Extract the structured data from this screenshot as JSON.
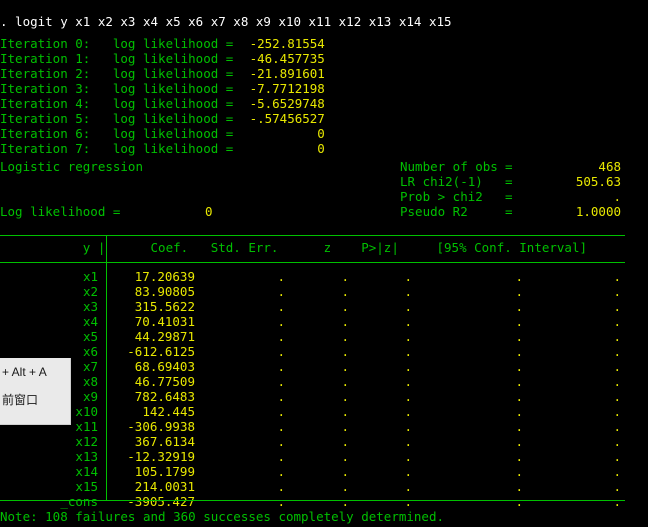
{
  "terminal": {
    "background_color": "#000000",
    "command_color": "#ffffff",
    "label_color": "#00c000",
    "value_color": "#e8e800"
  },
  "command": {
    "prompt": ".",
    "text": ". logit y x1 x2 x3 x4 x5 x6 x7 x8 x9 x10 x11 x12 x13 x14 x15"
  },
  "iterations": [
    {
      "line": "Iteration 0:   log likelihood = ",
      "value": "-252.81554"
    },
    {
      "line": "Iteration 1:   log likelihood = ",
      "value": "-46.457735"
    },
    {
      "line": "Iteration 2:   log likelihood = ",
      "value": "-21.891601"
    },
    {
      "line": "Iteration 3:   log likelihood = ",
      "value": "-7.7712198"
    },
    {
      "line": "Iteration 4:   log likelihood = ",
      "value": "-5.6529748"
    },
    {
      "line": "Iteration 5:   log likelihood = ",
      "value": "-.57456527"
    },
    {
      "line": "Iteration 6:   log likelihood = ",
      "value": "0"
    },
    {
      "line": "Iteration 7:   log likelihood = ",
      "value": "0"
    }
  ],
  "header": {
    "model_title": "Logistic regression",
    "log_likelihood_label": "Log likelihood = ",
    "log_likelihood_value": "0",
    "stats": [
      {
        "label": "Number of obs",
        "eq": "=",
        "value": "468"
      },
      {
        "label": "LR chi2(-1)",
        "eq": "=",
        "value": "505.63"
      },
      {
        "label": "Prob > chi2",
        "eq": "=",
        "value": "."
      },
      {
        "label": "Pseudo R2",
        "eq": "=",
        "value": "1.0000"
      }
    ]
  },
  "table": {
    "dep_var_header": "y",
    "columns": [
      "Coef.",
      "Std. Err.",
      "z",
      "P>|z|",
      "[95% Conf. Interval]"
    ],
    "header_line": "           y |      Coef.   Std. Err.      z    P>|z|     [95% Conf. Interval]",
    "missing_symbol": ".",
    "rows": [
      {
        "name": "x1",
        "coef": "17.20639",
        "stderr": ".",
        "z": ".",
        "p": ".",
        "ci_low": ".",
        "ci_high": "."
      },
      {
        "name": "x2",
        "coef": "83.90805",
        "stderr": ".",
        "z": ".",
        "p": ".",
        "ci_low": ".",
        "ci_high": "."
      },
      {
        "name": "x3",
        "coef": "315.5622",
        "stderr": ".",
        "z": ".",
        "p": ".",
        "ci_low": ".",
        "ci_high": "."
      },
      {
        "name": "x4",
        "coef": "70.41031",
        "stderr": ".",
        "z": ".",
        "p": ".",
        "ci_low": ".",
        "ci_high": "."
      },
      {
        "name": "x5",
        "coef": "44.29871",
        "stderr": ".",
        "z": ".",
        "p": ".",
        "ci_low": ".",
        "ci_high": "."
      },
      {
        "name": "x6",
        "coef": "-612.6125",
        "stderr": ".",
        "z": ".",
        "p": ".",
        "ci_low": ".",
        "ci_high": "."
      },
      {
        "name": "x7",
        "coef": "68.69403",
        "stderr": ".",
        "z": ".",
        "p": ".",
        "ci_low": ".",
        "ci_high": "."
      },
      {
        "name": "x8",
        "coef": "46.77509",
        "stderr": ".",
        "z": ".",
        "p": ".",
        "ci_low": ".",
        "ci_high": "."
      },
      {
        "name": "x9",
        "coef": "782.6483",
        "stderr": ".",
        "z": ".",
        "p": ".",
        "ci_low": ".",
        "ci_high": "."
      },
      {
        "name": "x10",
        "coef": "142.445",
        "stderr": ".",
        "z": ".",
        "p": ".",
        "ci_low": ".",
        "ci_high": "."
      },
      {
        "name": "x11",
        "coef": "-306.9938",
        "stderr": ".",
        "z": ".",
        "p": ".",
        "ci_low": ".",
        "ci_high": "."
      },
      {
        "name": "x12",
        "coef": "367.6134",
        "stderr": ".",
        "z": ".",
        "p": ".",
        "ci_low": ".",
        "ci_high": "."
      },
      {
        "name": "x13",
        "coef": "-12.32919",
        "stderr": ".",
        "z": ".",
        "p": ".",
        "ci_low": ".",
        "ci_high": "."
      },
      {
        "name": "x14",
        "coef": "105.1799",
        "stderr": ".",
        "z": ".",
        "p": ".",
        "ci_low": ".",
        "ci_high": "."
      },
      {
        "name": "x15",
        "coef": "214.0031",
        "stderr": ".",
        "z": ".",
        "p": ".",
        "ci_low": ".",
        "ci_high": "."
      },
      {
        "name": "_cons",
        "coef": "-3905.427",
        "stderr": ".",
        "z": ".",
        "p": ".",
        "ci_low": ".",
        "ci_high": "."
      }
    ]
  },
  "note": "Note: 108 failures and 360 successes completely determined.",
  "overlay": {
    "line1": "+ Alt + A",
    "line2": "前窗口"
  }
}
